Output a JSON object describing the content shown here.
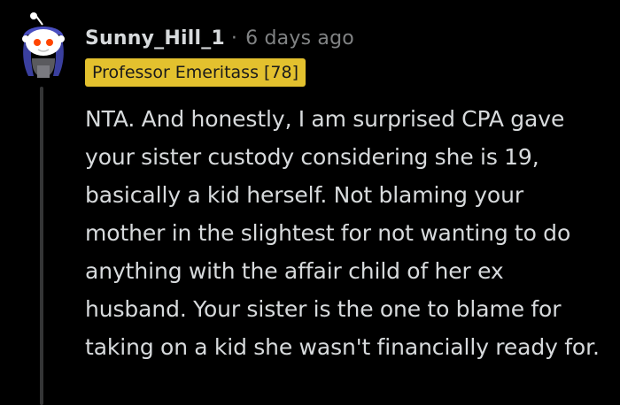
{
  "comment": {
    "author": {
      "username": "Sunny_Hill_1",
      "avatar_icon": "reddit-snoo-avatar-icon"
    },
    "separator": "·",
    "timestamp": "6 days ago",
    "flair": {
      "text": "Professor Emeritass [78]",
      "color": "#e3c12e"
    },
    "body": "NTA. And honestly, I am surprised CPA gave your sister custody considering she is 19, basically a kid herself. Not blaming your mother in the slightest for not wanting to do anything with the affair child of her ex husband. Your sister is the one to blame for taking on a kid she wasn't financially ready for."
  },
  "colors": {
    "background": "#000000",
    "text": "#d7dadc",
    "muted": "#818384",
    "thread_line": "#343536",
    "flair_bg": "#e3c12e"
  }
}
